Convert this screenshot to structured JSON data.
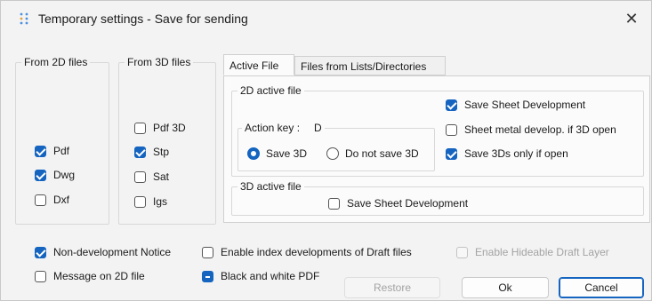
{
  "window": {
    "title": "Temporary settings - Save for sending",
    "close_glyph": "✕",
    "icon": "settings-dots-icon"
  },
  "from2d": {
    "title": "From 2D files",
    "items": [
      {
        "label": "Pdf",
        "checked": true
      },
      {
        "label": "Dwg",
        "checked": true
      },
      {
        "label": "Dxf",
        "checked": false
      }
    ]
  },
  "from3d": {
    "title": "From 3D files",
    "items": [
      {
        "label": "Pdf 3D",
        "checked": false
      },
      {
        "label": "Stp",
        "checked": true
      },
      {
        "label": "Sat",
        "checked": false
      },
      {
        "label": "Igs",
        "checked": false
      }
    ]
  },
  "tabs": [
    {
      "label": "Active File",
      "active": true
    },
    {
      "label": "Files from Lists/Directories",
      "active": false
    }
  ],
  "active2d": {
    "title": "2D active file",
    "action_key_label": "Action key :",
    "action_key_value": "D",
    "radios": [
      {
        "label": "Save 3D",
        "selected": true
      },
      {
        "label": "Do not save 3D",
        "selected": false
      }
    ],
    "options": [
      {
        "label": "Save Sheet Development",
        "checked": true
      },
      {
        "label": "Sheet metal develop. if 3D open",
        "checked": false
      },
      {
        "label": "Save 3Ds only if open",
        "checked": true
      }
    ]
  },
  "active3d": {
    "title": "3D active file",
    "save_sheet": {
      "label": "Save Sheet Development",
      "checked": false
    }
  },
  "bottom": {
    "non_dev": {
      "label": "Non-development Notice",
      "checked": true
    },
    "message_2d": {
      "label": "Message on 2D file",
      "checked": false
    },
    "enable_index": {
      "label": "Enable index developments of Draft files",
      "checked": false
    },
    "black_white": {
      "label": "Black and white PDF",
      "state": "indeterminate"
    },
    "hideable": {
      "label": "Enable Hideable Draft Layer",
      "checked": false,
      "disabled": true
    }
  },
  "buttons": {
    "restore": "Restore",
    "ok": "Ok",
    "cancel": "Cancel"
  },
  "colors": {
    "accent": "#1464c0",
    "dialog_bg": "#f3f3f3",
    "panel_bg": "#fbfbfb"
  }
}
